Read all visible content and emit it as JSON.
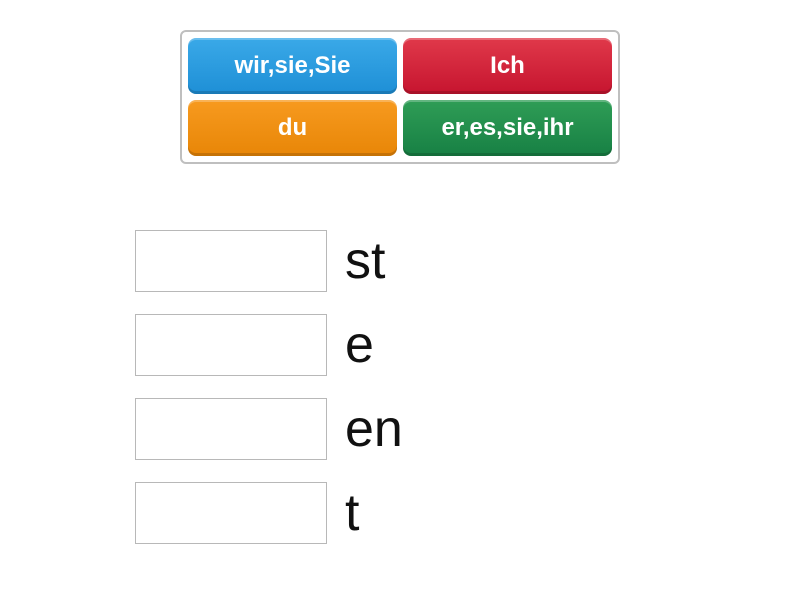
{
  "tiles": {
    "wir_sie_Sie": "wir,sie,Sie",
    "ich": "Ich",
    "du": "du",
    "er_es_sie_ihr": "er,es,sie,ihr"
  },
  "endings": {
    "r1": "st",
    "r2": "e",
    "r3": "en",
    "r4": "t"
  },
  "colors": {
    "blue": "#1e8fd6",
    "red": "#c6142f",
    "orange": "#e88607",
    "green": "#178044"
  }
}
